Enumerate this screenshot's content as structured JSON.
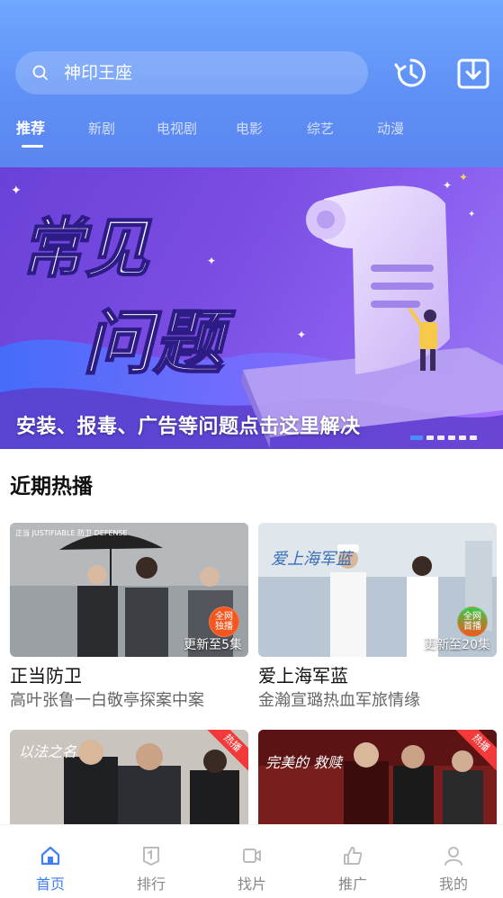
{
  "header": {
    "search_text": "神印王座",
    "tabs": [
      {
        "label": "推荐",
        "active": true
      },
      {
        "label": "新剧",
        "active": false
      },
      {
        "label": "电视剧",
        "active": false
      },
      {
        "label": "电影",
        "active": false
      },
      {
        "label": "综艺",
        "active": false
      },
      {
        "label": "动漫",
        "active": false
      }
    ],
    "icons": [
      "search-icon",
      "history-icon",
      "download-icon"
    ]
  },
  "banner": {
    "headline_line1": "常见",
    "headline_line2": "问题",
    "caption": "安装、报毒、广告等问题点击这里解决",
    "slide_count": 6,
    "active_slide": 1
  },
  "section": {
    "title": "近期热播",
    "cards": [
      {
        "title": "正当防卫",
        "subtitle": "高叶张鲁一白敬亭探案中案",
        "episode": "更新至5集",
        "badge": "全网独播",
        "poster_text": "正当 JUSTIFIABLE 防卫 DEFENSE"
      },
      {
        "title": "爱上海军蓝",
        "subtitle": "金瀚宣璐热血军旅情缘",
        "episode": "更新至20集",
        "badge": "全网首播",
        "poster_text": "爱上海军蓝"
      },
      {
        "title": "",
        "subtitle": "",
        "episode": "",
        "badge": "热播",
        "poster_text": "以法之名"
      },
      {
        "title": "",
        "subtitle": "",
        "episode": "",
        "badge": "热播",
        "poster_text": "完美的 救赎"
      }
    ]
  },
  "bottom_nav": [
    {
      "label": "首页",
      "icon": "home-icon",
      "active": true
    },
    {
      "label": "排行",
      "icon": "ranking-icon",
      "active": false
    },
    {
      "label": "找片",
      "icon": "video-icon",
      "active": false
    },
    {
      "label": "推广",
      "icon": "promote-icon",
      "active": false
    },
    {
      "label": "我的",
      "icon": "profile-icon",
      "active": false
    }
  ],
  "colors": {
    "accent": "#3f7ff3",
    "header_top": "#6fa8ff",
    "banner_purple": "#7a4ce2",
    "badge_orange": "#f4561f",
    "hot_red": "#f23a3a"
  }
}
